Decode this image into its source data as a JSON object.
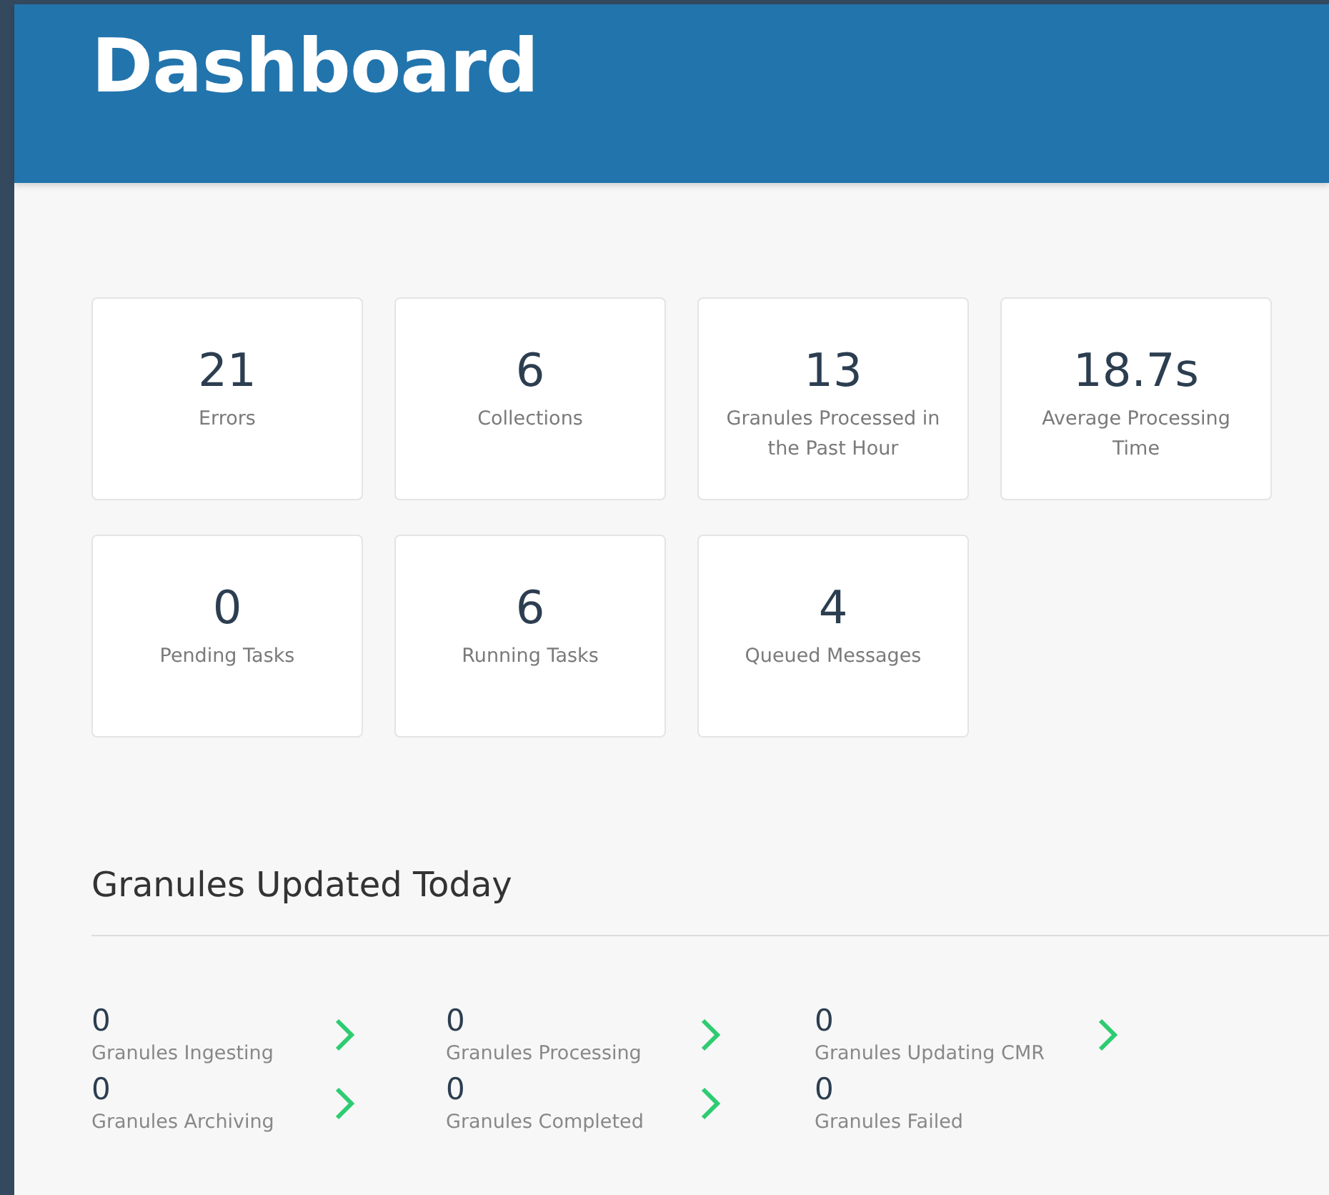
{
  "header": {
    "title": "Dashboard"
  },
  "stats": [
    {
      "value": "21",
      "label": "Errors"
    },
    {
      "value": "6",
      "label": "Collections"
    },
    {
      "value": "13",
      "label": "Granules Processed in the Past Hour"
    },
    {
      "value": "18.7s",
      "label": "Average Processing Time"
    },
    {
      "value": "0",
      "label": "Pending Tasks"
    },
    {
      "value": "6",
      "label": "Running Tasks"
    },
    {
      "value": "4",
      "label": "Queued Messages"
    }
  ],
  "granules": {
    "title": "Granules Updated Today",
    "items": [
      {
        "value": "0",
        "label": "Granules Ingesting",
        "arrow": true
      },
      {
        "value": "0",
        "label": "Granules Processing",
        "arrow": true
      },
      {
        "value": "0",
        "label": "Granules Updating CMR",
        "arrow": true
      },
      {
        "value": "0",
        "label": "Granules Archiving",
        "arrow": true
      },
      {
        "value": "0",
        "label": "Granules Completed",
        "arrow": true
      },
      {
        "value": "0",
        "label": "Granules Failed",
        "arrow": false
      }
    ]
  }
}
